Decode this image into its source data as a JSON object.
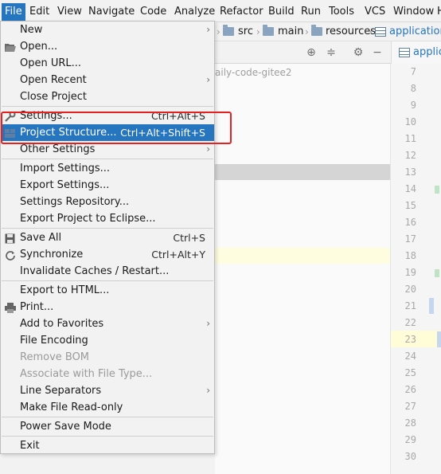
{
  "menubar": {
    "items": [
      "File",
      "Edit",
      "View",
      "Navigate",
      "Code",
      "Analyze",
      "Refactor",
      "Build",
      "Run",
      "Tools",
      "VCS",
      "Window",
      "H"
    ]
  },
  "navbar": {
    "crumbs": [
      "src",
      "main",
      "resources",
      "application"
    ]
  },
  "toolbar": {
    "tab_label": "applica"
  },
  "project": {
    "ghost_text": "aily-code-gitee2"
  },
  "gutter": {
    "line_numbers": [
      "7",
      "8",
      "9",
      "10",
      "11",
      "12",
      "13",
      "14",
      "15",
      "16",
      "17",
      "18",
      "19",
      "20",
      "21",
      "22",
      "23",
      "24",
      "25",
      "26",
      "27",
      "28",
      "29",
      "30"
    ]
  },
  "filemenu": {
    "new": "New",
    "open": "Open...",
    "open_url": "Open URL...",
    "open_recent": "Open Recent",
    "close_project": "Close Project",
    "settings": "Settings...",
    "settings_shortcut": "Ctrl+Alt+S",
    "project_structure": "Project Structure...",
    "project_structure_shortcut": "Ctrl+Alt+Shift+S",
    "other_settings": "Other Settings",
    "import_settings": "Import Settings...",
    "export_settings": "Export Settings...",
    "settings_repository": "Settings Repository...",
    "export_eclipse": "Export Project to Eclipse...",
    "save_all": "Save All",
    "save_all_shortcut": "Ctrl+S",
    "synchronize": "Synchronize",
    "synchronize_shortcut": "Ctrl+Alt+Y",
    "invalidate_caches": "Invalidate Caches / Restart...",
    "export_html": "Export to HTML...",
    "print": "Print...",
    "add_favorites": "Add to Favorites",
    "file_encoding": "File Encoding",
    "remove_bom": "Remove BOM",
    "associate_file_type": "Associate with File Type...",
    "line_separators": "Line Separators",
    "make_read_only": "Make File Read-only",
    "power_save": "Power Save Mode",
    "exit": "Exit"
  },
  "colors": {
    "accent": "#2675bf",
    "highlight_box": "#e52121"
  }
}
